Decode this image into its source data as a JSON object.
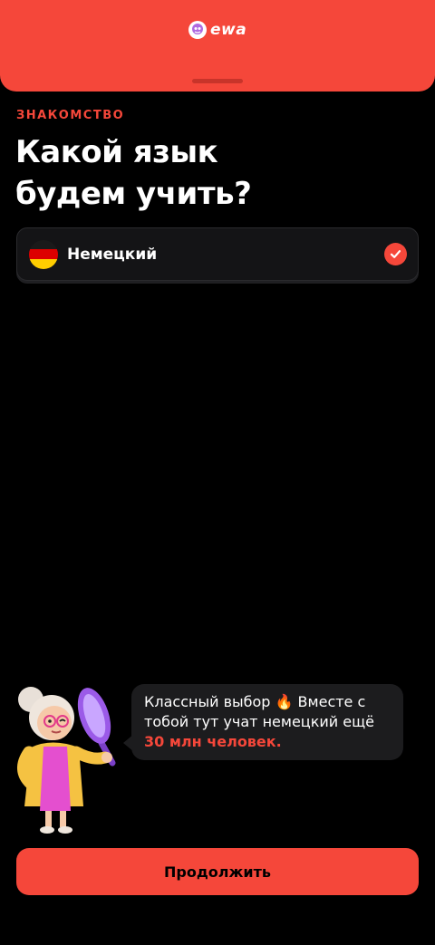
{
  "header": {
    "brand": "ewa",
    "logo_icon": "ewa-logo-icon",
    "accent_color": "#f5473a"
  },
  "step": {
    "section_label": "ЗНАКОМСТВО",
    "title_line1": "Какой язык",
    "title_line2": "будем учить?"
  },
  "languages": [
    {
      "name": "Немецкий",
      "flag_icon": "germany-flag-icon",
      "selected": true
    }
  ],
  "mascot": {
    "icon": "grandma-magnifier-mascot",
    "message_part1": "Классный выбор",
    "emoji": "🔥",
    "message_part2": "Вместе с тобой тут учат немецкий ещё",
    "message_highlight": "30 млн человек."
  },
  "footer": {
    "continue_label": "Продолжить"
  }
}
